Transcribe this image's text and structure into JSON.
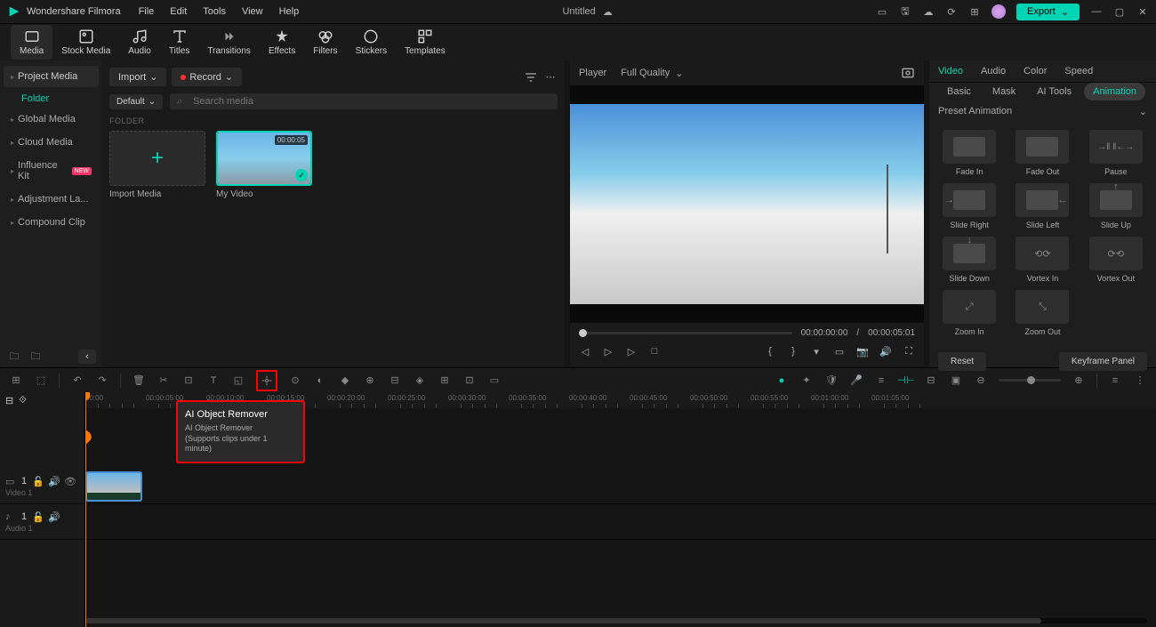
{
  "titlebar": {
    "app_name": "Wondershare Filmora",
    "menus": [
      "File",
      "Edit",
      "Tools",
      "View",
      "Help"
    ],
    "doc_title": "Untitled",
    "export_label": "Export"
  },
  "toptabs": [
    {
      "label": "Media",
      "icon": "media-icon"
    },
    {
      "label": "Stock Media",
      "icon": "stock-icon"
    },
    {
      "label": "Audio",
      "icon": "audio-icon"
    },
    {
      "label": "Titles",
      "icon": "titles-icon"
    },
    {
      "label": "Transitions",
      "icon": "transitions-icon"
    },
    {
      "label": "Effects",
      "icon": "effects-icon"
    },
    {
      "label": "Filters",
      "icon": "filters-icon"
    },
    {
      "label": "Stickers",
      "icon": "stickers-icon"
    },
    {
      "label": "Templates",
      "icon": "templates-icon"
    }
  ],
  "sidebar": {
    "items": [
      {
        "label": "Project Media",
        "selected": true
      },
      {
        "label": "Global Media"
      },
      {
        "label": "Cloud Media"
      },
      {
        "label": "Influence Kit",
        "badge": "NEW"
      },
      {
        "label": "Adjustment La..."
      },
      {
        "label": "Compound Clip"
      }
    ],
    "sub_label": "Folder"
  },
  "media": {
    "import_label": "Import",
    "record_label": "Record",
    "sort_label": "Default",
    "search_placeholder": "Search media",
    "folder_label": "FOLDER",
    "import_media_label": "Import Media",
    "clips": [
      {
        "name": "My Video",
        "duration": "00:00:05"
      }
    ]
  },
  "player": {
    "label": "Player",
    "quality": "Full Quality",
    "current_time": "00:00:00:00",
    "total_time": "00:00:05:01",
    "separator": "/"
  },
  "right_panel": {
    "tabs": [
      "Video",
      "Audio",
      "Color",
      "Speed"
    ],
    "subtabs": [
      "Basic",
      "Mask",
      "AI Tools",
      "Animation"
    ],
    "preset_label": "Preset Animation",
    "animations": [
      "Fade In",
      "Fade Out",
      "Pause",
      "Slide Right",
      "Slide Left",
      "Slide Up",
      "Slide Down",
      "Vortex In",
      "Vortex Out",
      "Zoom In",
      "Zoom Out"
    ],
    "reset_label": "Reset",
    "keyframe_label": "Keyframe Panel"
  },
  "tooltip": {
    "title": "AI Object Remover",
    "line1": "AI Object Remover",
    "line2": "(Supports clips under 1 minute)"
  },
  "timeline": {
    "ticks": [
      "00:00",
      "00:00:05:00",
      "00:00:10:00",
      "00:00:15:00",
      "00:00:20:00",
      "00:00:25:00",
      "00:00:30:00",
      "00:00:35:00",
      "00:00:40:00",
      "00:00:45:00",
      "00:00:50:00",
      "00:00:55:00",
      "00:01:00:00",
      "00:01:05:00"
    ],
    "video_track": "Video 1",
    "audio_track": "Audio 1",
    "track_num": "1"
  }
}
